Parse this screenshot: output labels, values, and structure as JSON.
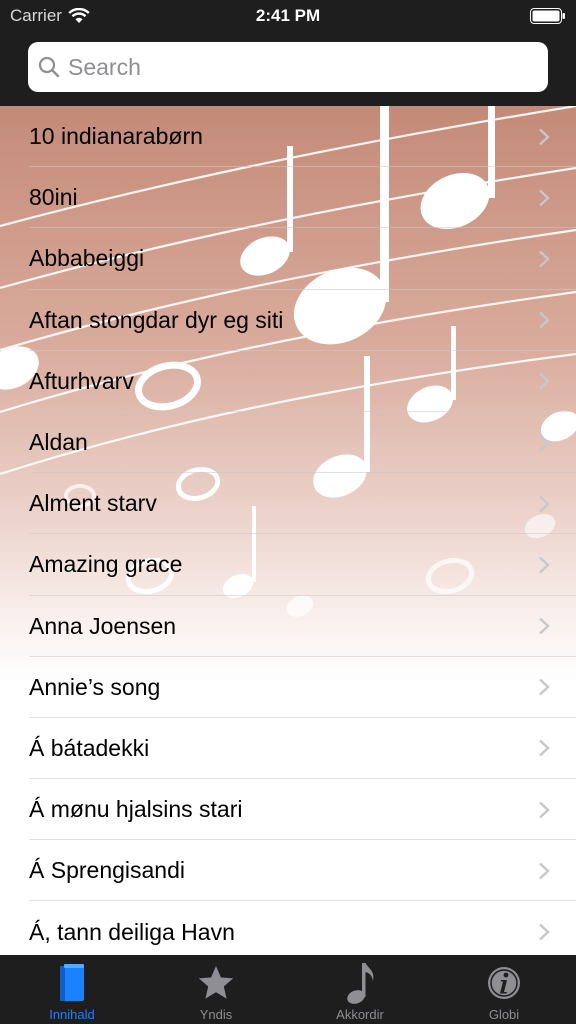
{
  "status_bar": {
    "carrier": "Carrier",
    "time": "2:41 PM",
    "wifi_icon": "wifi-icon",
    "battery_icon": "battery-icon"
  },
  "search": {
    "placeholder": "Search",
    "icon": "search-icon"
  },
  "list": {
    "items": [
      {
        "label": "10 indianarabørn"
      },
      {
        "label": "80ini"
      },
      {
        "label": "Abbabeiggi"
      },
      {
        "label": "Aftan stongdar dyr eg siti"
      },
      {
        "label": "Afturhvarv"
      },
      {
        "label": "Aldan"
      },
      {
        "label": "Alment starv"
      },
      {
        "label": "Amazing grace"
      },
      {
        "label": "Anna Joensen"
      },
      {
        "label": "Annie’s song"
      },
      {
        "label": "Á bátadekki"
      },
      {
        "label": "Á mønu hjalsins stari"
      },
      {
        "label": "Á Sprengisandi"
      },
      {
        "label": "Á, tann deiliga Havn"
      }
    ],
    "chevron_icon": "chevron-right-icon",
    "background_art": "music-notes-background"
  },
  "tab_bar": {
    "tabs": [
      {
        "label": "Innihald",
        "icon": "book-icon",
        "active": true
      },
      {
        "label": "Yndis",
        "icon": "star-icon",
        "active": false
      },
      {
        "label": "Akkordir",
        "icon": "music-note-icon",
        "active": false
      },
      {
        "label": "Globi",
        "icon": "info-icon",
        "active": false
      }
    ]
  },
  "colors": {
    "bars": "#1e1e1e",
    "active_tab": "#1a82fb",
    "inactive_tab": "#8e8e93",
    "gradient_top": "#c48a78"
  }
}
